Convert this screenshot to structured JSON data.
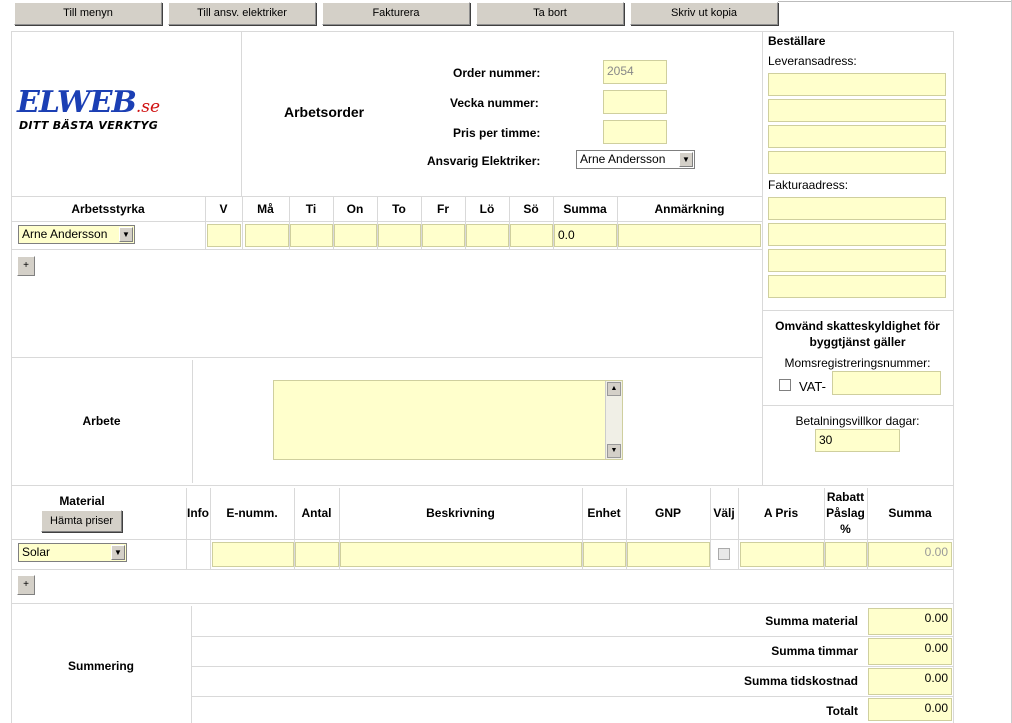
{
  "toolbar": {
    "menu": "Till menyn",
    "electricians": "Till ansv. elektriker",
    "invoice": "Fakturera",
    "delete": "Ta bort",
    "print": "Skriv ut kopia"
  },
  "logo": {
    "brand": "ELWEB",
    "tld": ".se",
    "tagline": "DITT BÄSTA VERKTYG"
  },
  "order": {
    "title": "Arbetsorder",
    "order_label": "Order nummer:",
    "order_value": "2054",
    "week_label": "Vecka nummer:",
    "price_label": "Pris per timme:",
    "electrician_label": "Ansvarig Elektriker:",
    "electrician_value": "Arne Andersson"
  },
  "workforce": {
    "headers": [
      "Arbetsstyrka",
      "V",
      "Må",
      "Ti",
      "On",
      "To",
      "Fr",
      "Lö",
      "Sö",
      "Summa",
      "Anmärkning"
    ],
    "worker": "Arne Andersson",
    "sum": "0.0",
    "add": "+"
  },
  "orderer": {
    "title": "Beställare",
    "delivery_label": "Leveransadress:",
    "invoice_label": "Fakturaadress:",
    "reverse_vat_title": "Omvänd skatteskyldighet för byggtjänst gäller",
    "vat_reg_label": "Momsregistreringsnummer:",
    "vat_prefix": "VAT-",
    "payment_label": "Betalningsvillkor dagar:",
    "payment_value": "30"
  },
  "work": {
    "label": "Arbete"
  },
  "material": {
    "label": "Material",
    "fetch_prices": "Hämta priser",
    "headers": [
      "Info",
      "E-numm.",
      "Antal",
      "Beskrivning",
      "Enhet",
      "GNP",
      "Välj",
      "A Pris",
      "Rabatt Påslag %",
      "Summa"
    ],
    "supplier": "Solar",
    "row_sum": "0.00",
    "add": "+"
  },
  "summary": {
    "label": "Summering",
    "material_label": "Summa material",
    "material_value": "0.00",
    "hours_label": "Summa timmar",
    "hours_value": "0.00",
    "time_cost_label": "Summa tidskostnad",
    "time_cost_value": "0.00",
    "total_label": "Totalt",
    "total_value": "0.00"
  }
}
